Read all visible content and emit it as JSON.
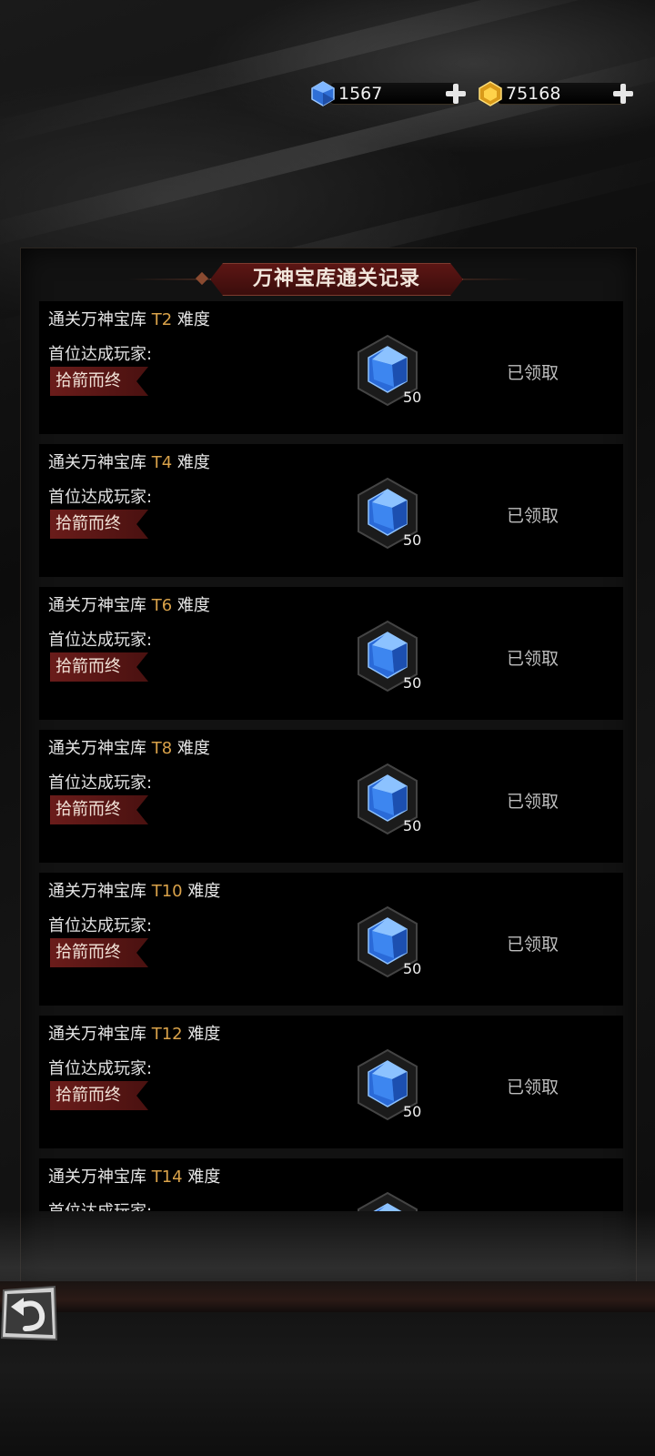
{
  "currencies": [
    {
      "name": "diamond",
      "icon": "blue-gem-icon",
      "value": "1567",
      "color": "#3a7fe0"
    },
    {
      "name": "gold",
      "icon": "gold-gem-icon",
      "value": "75168",
      "color": "#e8b830"
    }
  ],
  "panel": {
    "title": "万神宝库通关记录"
  },
  "records": [
    {
      "prefix": "通关万神宝库 ",
      "tier": "T2",
      "suffix": " 难度",
      "first_label": "首位达成玩家:",
      "player": "拾箭而终",
      "reward_icon": "blue-gem-icon",
      "reward_count": "50",
      "status": "已领取"
    },
    {
      "prefix": "通关万神宝库 ",
      "tier": "T4",
      "suffix": " 难度",
      "first_label": "首位达成玩家:",
      "player": "拾箭而终",
      "reward_icon": "blue-gem-icon",
      "reward_count": "50",
      "status": "已领取"
    },
    {
      "prefix": "通关万神宝库 ",
      "tier": "T6",
      "suffix": " 难度",
      "first_label": "首位达成玩家:",
      "player": "拾箭而终",
      "reward_icon": "blue-gem-icon",
      "reward_count": "50",
      "status": "已领取"
    },
    {
      "prefix": "通关万神宝库 ",
      "tier": "T8",
      "suffix": " 难度",
      "first_label": "首位达成玩家:",
      "player": "拾箭而终",
      "reward_icon": "blue-gem-icon",
      "reward_count": "50",
      "status": "已领取"
    },
    {
      "prefix": "通关万神宝库 ",
      "tier": "T10",
      "suffix": " 难度",
      "first_label": "首位达成玩家:",
      "player": "拾箭而终",
      "reward_icon": "blue-gem-icon",
      "reward_count": "50",
      "status": "已领取"
    },
    {
      "prefix": "通关万神宝库 ",
      "tier": "T12",
      "suffix": " 难度",
      "first_label": "首位达成玩家:",
      "player": "拾箭而终",
      "reward_icon": "blue-gem-icon",
      "reward_count": "50",
      "status": "已领取"
    },
    {
      "prefix": "通关万神宝库 ",
      "tier": "T14",
      "suffix": " 难度",
      "first_label": "首位达成玩家:",
      "player": "",
      "reward_icon": "blue-gem-icon",
      "reward_count": "",
      "status": ""
    }
  ],
  "back_button": {
    "icon": "back-arrow-icon"
  }
}
